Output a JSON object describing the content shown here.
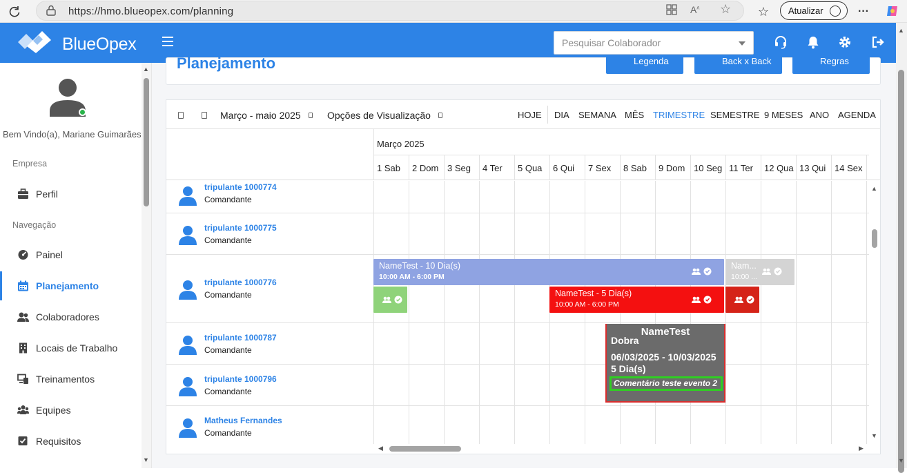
{
  "browser": {
    "url": "https://hmo.blueopex.com/planning",
    "update_label": "Atualizar"
  },
  "app": {
    "brand": "BlueOpex",
    "search_placeholder": "Pesquisar Colaborador"
  },
  "sidebar": {
    "welcome": "Bem Vindo(a), Mariane Guimarães",
    "section_company": "Empresa",
    "section_nav": "Navegação",
    "items": [
      {
        "label": "Perfil",
        "icon": "briefcase-icon"
      },
      {
        "label": "Painel",
        "icon": "dashboard-icon"
      },
      {
        "label": "Planejamento",
        "icon": "calendar-icon"
      },
      {
        "label": "Colaboradores",
        "icon": "users-icon"
      },
      {
        "label": "Locais de Trabalho",
        "icon": "building-icon"
      },
      {
        "label": "Treinamentos",
        "icon": "training-icon"
      },
      {
        "label": "Equipes",
        "icon": "team-icon"
      },
      {
        "label": "Requisitos",
        "icon": "checkbox-icon"
      }
    ]
  },
  "page": {
    "title": "Planejamento",
    "buttons": [
      "Legenda",
      "Back x Back",
      "Regras"
    ]
  },
  "toolbar": {
    "range": "Março - maio 2025",
    "options": "Opções de Visualização",
    "today": "HOJE",
    "views": [
      "DIA",
      "SEMANA",
      "MÊS",
      "TRIMESTRE",
      "SEMESTRE",
      "9 MESES",
      "ANO",
      "AGENDA"
    ],
    "selected_view": "TRIMESTRE"
  },
  "calendar": {
    "month": "Março 2025",
    "days": [
      "1 Sab",
      "2 Dom",
      "3 Seg",
      "4 Ter",
      "5 Qua",
      "6 Qui",
      "7 Sex",
      "8 Sab",
      "9 Dom",
      "10 Seg",
      "11 Ter",
      "12 Qua",
      "13 Qui",
      "14 Sex"
    ]
  },
  "crew": [
    {
      "name": "tripulante 1000774",
      "role": "Comandante"
    },
    {
      "name": "tripulante 1000775",
      "role": "Comandante"
    },
    {
      "name": "tripulante 1000776",
      "role": "Comandante"
    },
    {
      "name": "tripulante 1000787",
      "role": "Comandante"
    },
    {
      "name": "tripulante 1000796",
      "role": "Comandante"
    },
    {
      "name": "Matheus Fernandes",
      "role": "Comandante"
    }
  ],
  "events": {
    "e1": {
      "title": "NameTest - 10 Dia(s)",
      "time": "10:00 AM - 6:00 PM",
      "color": "#8fa3e2"
    },
    "e2": {
      "title": "Nam...",
      "time": "10:00 ...",
      "color": "#d4d4d4"
    },
    "e3": {
      "title": "NameTest - 5 Dia(s)",
      "time": "10:00 AM - 6:00 PM",
      "color": "#f41010"
    },
    "e4": {
      "color": "#8fd37a"
    },
    "e5": {
      "color": "#d52318"
    }
  },
  "tooltip": {
    "title": "NameTest",
    "type": "Dobra",
    "dates": "06/03/2025 - 10/03/2025",
    "duration": "5 Dia(s)",
    "comment": "Comentário teste evento 2"
  }
}
